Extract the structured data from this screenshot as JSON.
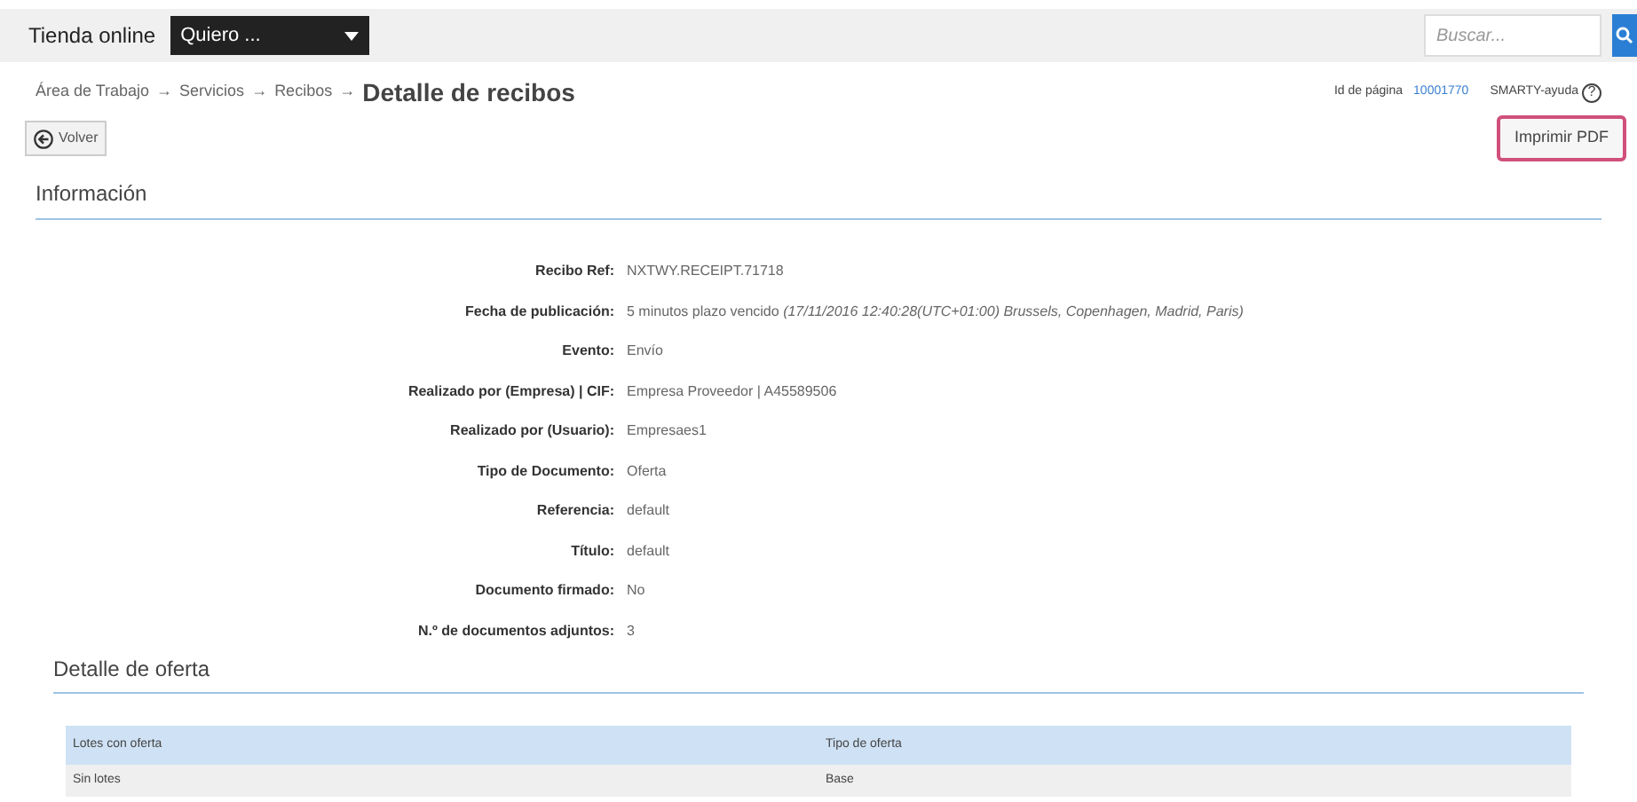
{
  "topbar": {
    "brand": "Tienda online",
    "dropdown": "Quiero ...",
    "search": {
      "placeholder": "Buscar..."
    }
  },
  "breadcrumb": {
    "links": [
      "Área de Trabajo",
      "Servicios",
      "Recibos"
    ],
    "separator": "→",
    "current": "Detalle de recibos"
  },
  "page_info": {
    "label": "Id de página",
    "id": "10001770",
    "help": "SMARTY-ayuda",
    "help_icon": "?"
  },
  "buttons": {
    "back": "Volver",
    "print": "Imprimir PDF"
  },
  "sections": [
    {
      "title": "Información"
    },
    {
      "title": "Detalle de oferta"
    }
  ],
  "fields": [
    {
      "label": "Recibo Ref:",
      "value": "NXTWY.RECEIPT.71718"
    },
    {
      "label": "Fecha de publicación:",
      "value": "5 minutos plazo vencido *(17/11/2016 12:40:28(UTC+01:00) Brussels, Copenhagen, Madrid, Paris)*"
    },
    {
      "label": "Evento:",
      "value": "Envío"
    },
    {
      "label": "Realizado por (Empresa) | CIF:",
      "value": "Empresa Proveedor | A45589506"
    },
    {
      "label": "Realizado por (Usuario):",
      "value": "Empresaes1"
    },
    {
      "label": "Tipo de Documento:",
      "value": "Oferta"
    },
    {
      "label": "Referencia:",
      "value": "default"
    },
    {
      "label": "Título:",
      "value": "default"
    },
    {
      "label": "Documento firmado:",
      "value": "No"
    },
    {
      "label": "N.º de documentos adjuntos:",
      "value": "3"
    }
  ],
  "table": {
    "columns": [
      "Lotes con oferta",
      "Tipo de oferta"
    ],
    "rows": [
      [
        "Sin lotes",
        "Base"
      ]
    ]
  }
}
